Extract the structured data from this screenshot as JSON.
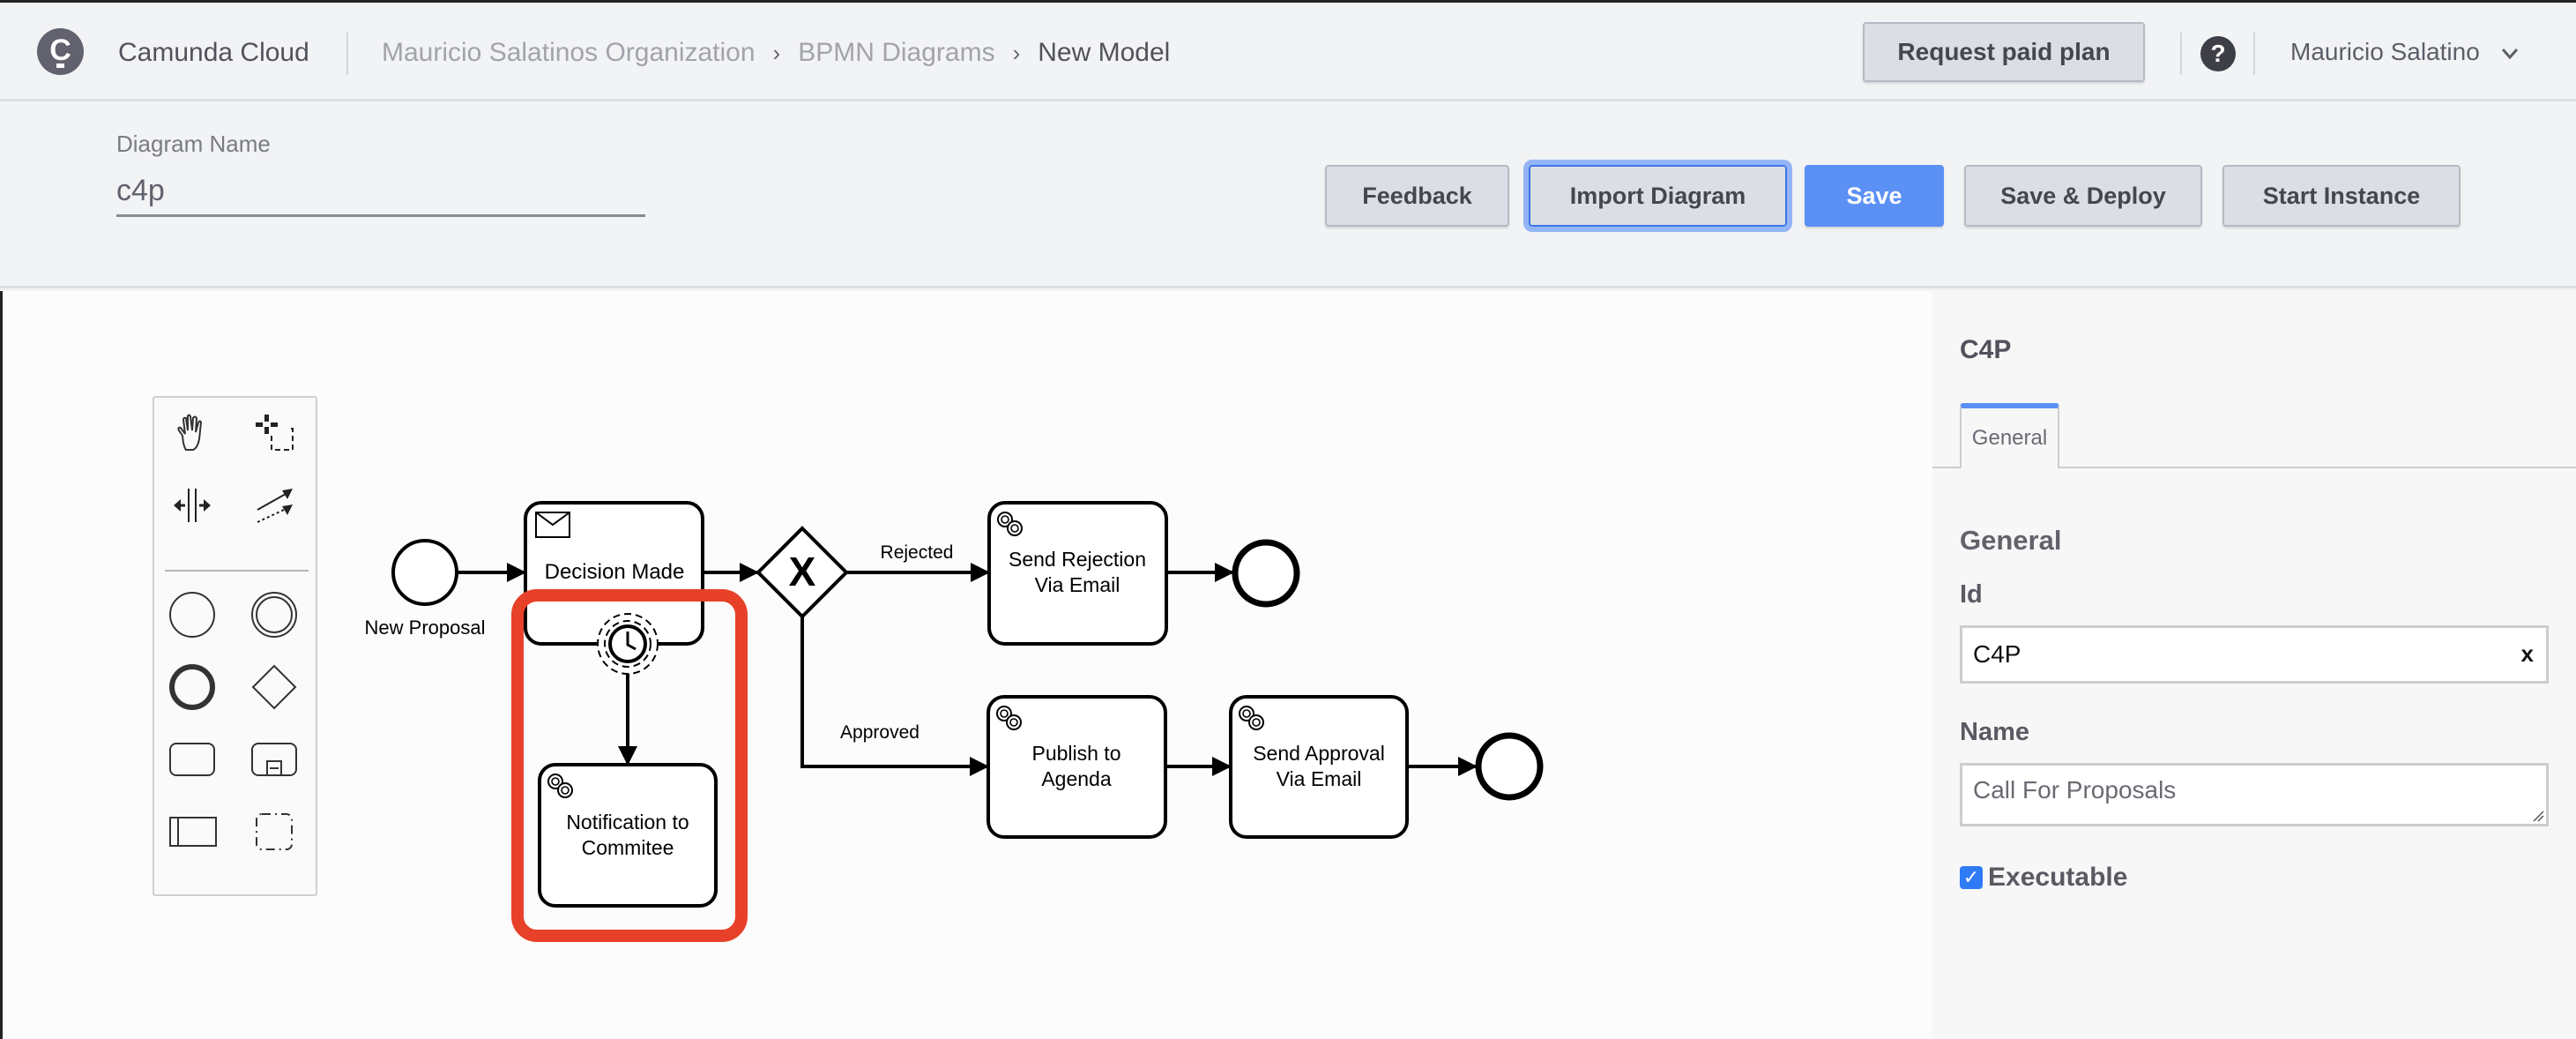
{
  "header": {
    "brand": "Camunda Cloud",
    "logo_letter": "C",
    "breadcrumb": [
      "Mauricio Salatinos Organization",
      "BPMN Diagrams",
      "New Model"
    ],
    "breadcrumb_separator": "›",
    "request_plan_label": "Request paid plan",
    "help_label": "?",
    "user_name": "Mauricio Salatino"
  },
  "toolbar": {
    "diagram_name_label": "Diagram Name",
    "diagram_name_value": "c4p",
    "buttons": {
      "feedback": "Feedback",
      "import": "Import Diagram",
      "save": "Save",
      "save_deploy": "Save & Deploy",
      "start_instance": "Start Instance"
    }
  },
  "palette": {
    "tools": [
      "hand-tool",
      "lasso-tool",
      "space-tool",
      "global-connect-tool"
    ],
    "shapes": [
      "start-event",
      "intermediate-event",
      "end-event",
      "gateway",
      "task",
      "subprocess",
      "pool",
      "group"
    ]
  },
  "diagram": {
    "start_event_label": "New Proposal",
    "tasks": {
      "decision_made": "Decision Made",
      "notification_l1": "Notification to",
      "notification_l2": "Commitee",
      "rejection_l1": "Send Rejection",
      "rejection_l2": "Via Email",
      "publish_l1": "Publish to",
      "publish_l2": "Agenda",
      "approval_l1": "Send Approval",
      "approval_l2": "Via Email"
    },
    "gateway_marker": "X",
    "flow_labels": {
      "rejected": "Rejected",
      "approved": "Approved"
    },
    "highlight_color": "#e8412a"
  },
  "properties": {
    "title": "C4P",
    "tab_label": "General",
    "section_heading": "General",
    "id_label": "Id",
    "id_value": "C4P",
    "clear_label": "x",
    "name_label": "Name",
    "name_value": "Call For Proposals",
    "executable_label": "Executable",
    "executable_checked": true,
    "accent_color": "#5b90f5"
  }
}
